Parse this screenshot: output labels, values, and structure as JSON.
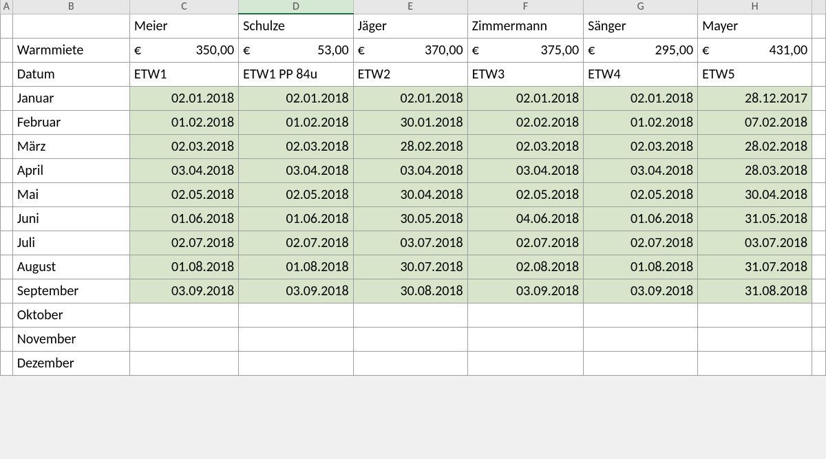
{
  "columns": [
    "A",
    "B",
    "C",
    "D",
    "E",
    "F",
    "G",
    "H"
  ],
  "selectedColumn": "D",
  "rowLabels": {
    "tenants": "",
    "warm": "Warmmiete",
    "datum": "Datum",
    "months": [
      "Januar",
      "Februar",
      "März",
      "April",
      "Mai",
      "Juni",
      "Juli",
      "August",
      "September",
      "Oktober",
      "November",
      "Dezember"
    ]
  },
  "tenants": [
    "Meier",
    "Schulze",
    "Jäger",
    "Zimmermann",
    "Sänger",
    "Mayer"
  ],
  "rents": [
    "350,00",
    "53,00",
    "370,00",
    "375,00",
    "295,00",
    "431,00"
  ],
  "currency": "€",
  "codes": [
    "ETW1",
    "ETW1 PP 84u",
    "ETW2",
    "ETW3",
    "ETW4",
    "ETW5"
  ],
  "dates": [
    [
      "02.01.2018",
      "02.01.2018",
      "02.01.2018",
      "02.01.2018",
      "02.01.2018",
      "28.12.2017"
    ],
    [
      "01.02.2018",
      "01.02.2018",
      "30.01.2018",
      "02.02.2018",
      "01.02.2018",
      "07.02.2018"
    ],
    [
      "02.03.2018",
      "02.03.2018",
      "28.02.2018",
      "02.03.2018",
      "02.03.2018",
      "28.02.2018"
    ],
    [
      "03.04.2018",
      "03.04.2018",
      "03.04.2018",
      "03.04.2018",
      "03.04.2018",
      "28.03.2018"
    ],
    [
      "02.05.2018",
      "02.05.2018",
      "30.04.2018",
      "02.05.2018",
      "02.05.2018",
      "30.04.2018"
    ],
    [
      "01.06.2018",
      "01.06.2018",
      "30.05.2018",
      "04.06.2018",
      "01.06.2018",
      "31.05.2018"
    ],
    [
      "02.07.2018",
      "02.07.2018",
      "03.07.2018",
      "02.07.2018",
      "02.07.2018",
      "03.07.2018"
    ],
    [
      "01.08.2018",
      "01.08.2018",
      "30.07.2018",
      "02.08.2018",
      "01.08.2018",
      "31.07.2018"
    ],
    [
      "03.09.2018",
      "03.09.2018",
      "30.08.2018",
      "03.09.2018",
      "03.09.2018",
      "31.08.2018"
    ],
    [
      "",
      "",
      "",
      "",
      "",
      ""
    ],
    [
      "",
      "",
      "",
      "",
      "",
      ""
    ],
    [
      "",
      "",
      "",
      "",
      "",
      ""
    ]
  ]
}
